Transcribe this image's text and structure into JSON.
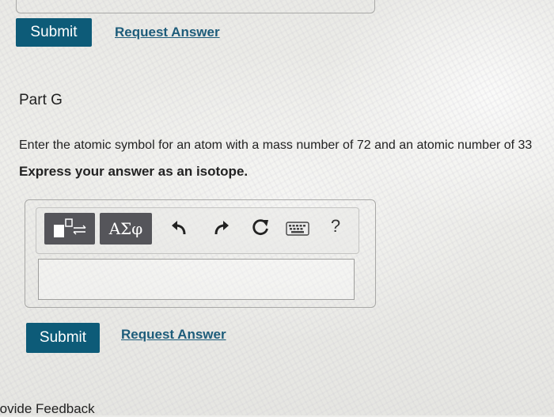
{
  "previous_part": {
    "submit_label": "Submit",
    "request_answer_label": "Request Answer"
  },
  "part": {
    "title": "Part G",
    "question": "Enter the atomic symbol for an atom with a mass number of 72 and an atomic number of 33",
    "instruction": "Express your answer as an isotope."
  },
  "toolbar": {
    "greek_label": "ΑΣφ",
    "help_label": "?",
    "icons": [
      "templates-icon",
      "undo-icon",
      "redo-icon",
      "reset-icon",
      "keyboard-icon"
    ]
  },
  "answer": {
    "value": "",
    "placeholder": ""
  },
  "actions": {
    "submit_label": "Submit",
    "request_answer_label": "Request Answer"
  },
  "footer": {
    "feedback_label": "rovide Feedback"
  },
  "colors": {
    "primary_button": "#0d5b78",
    "link": "#1d5c7a",
    "toolbar_button": "#55555a"
  }
}
